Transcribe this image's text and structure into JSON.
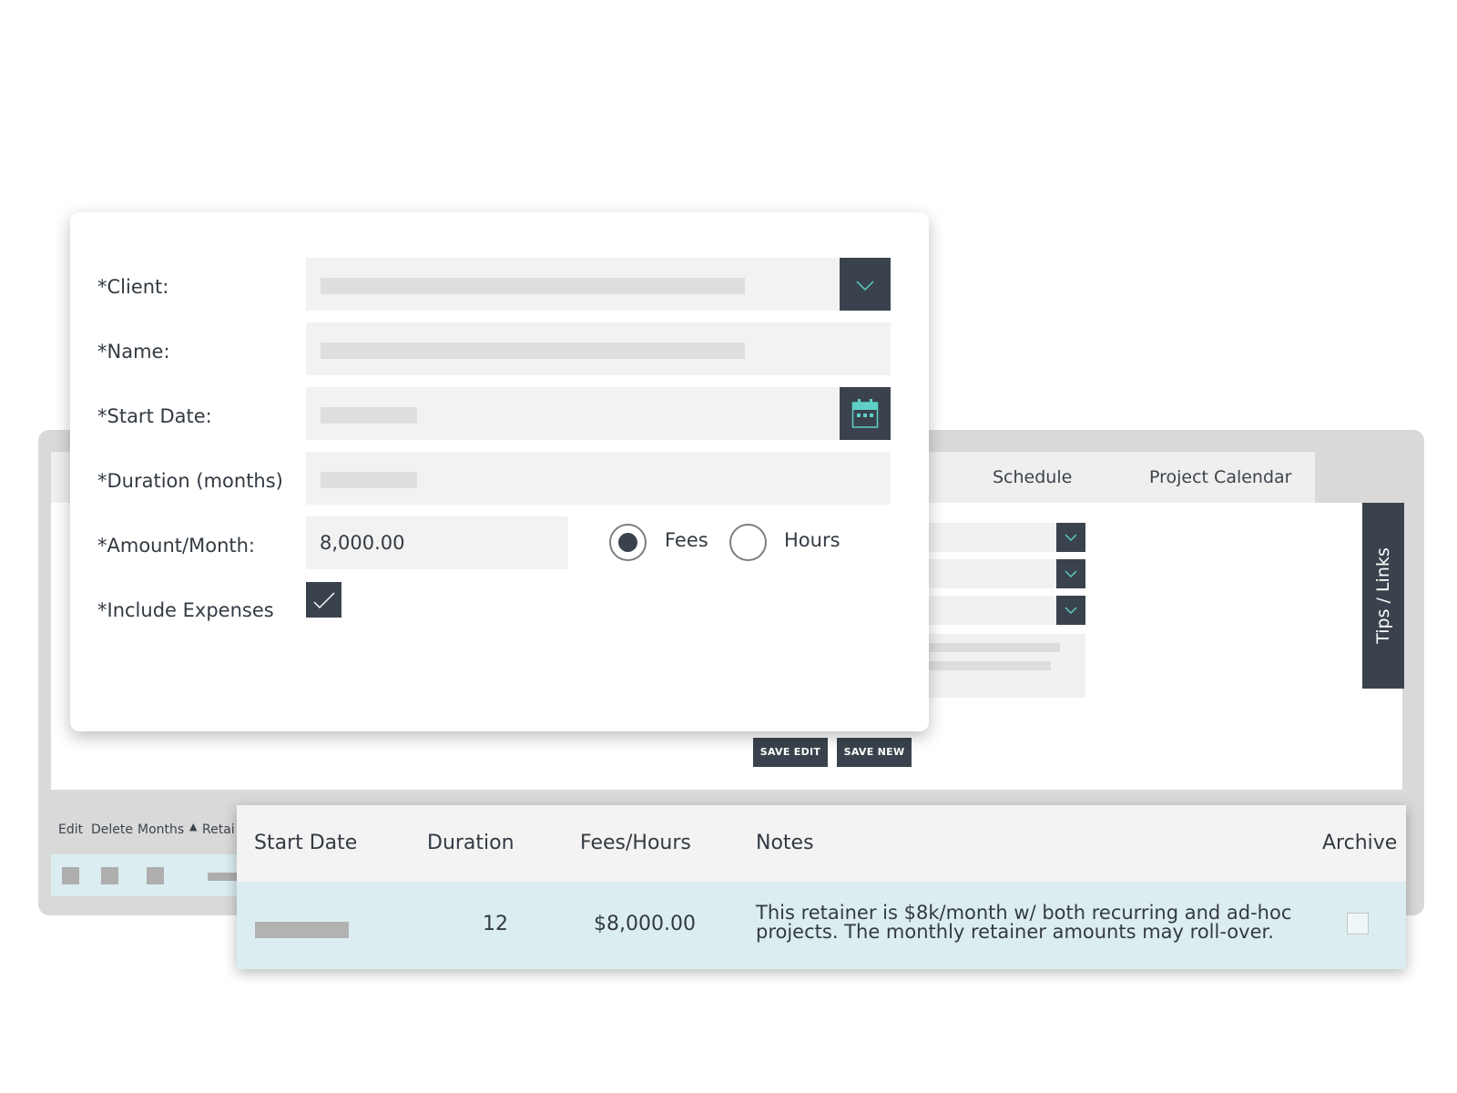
{
  "background_app": {
    "tabs": [
      "Schedule",
      "Project Calendar"
    ],
    "tips_tab_label": "Tips / Links",
    "buttons": {
      "save_edit": "SAVE EDIT",
      "save_new": "SAVE NEW"
    },
    "actions": {
      "edit": "Edit",
      "delete": "Delete",
      "months": "Months",
      "retainer_partial": "Retai"
    }
  },
  "form": {
    "client_label": "*Client:",
    "name_label": "*Name:",
    "start_date_label": "*Start Date:",
    "duration_label": "*Duration (months)",
    "amount_label": "*Amount/Month:",
    "amount_value": "8,000.00",
    "include_expenses_label": "*Include Expenses",
    "include_expenses_checked": true,
    "type_options": [
      "Fees",
      "Hours"
    ],
    "type_selected": "Fees",
    "colors": {
      "dark": "#3a434d",
      "calendar_accent": "#5ed0c8"
    }
  },
  "table": {
    "columns": [
      "Start Date",
      "Duration",
      "Fees/Hours",
      "Notes",
      "Archive"
    ],
    "rows": [
      {
        "duration": "12",
        "fees_hours": "$8,000.00",
        "notes_line1": "This retainer is $8k/month w/ both recurring and ad-hoc",
        "notes_line2": "projects. The monthly retainer amounts may roll-over.",
        "archived": false
      }
    ]
  }
}
